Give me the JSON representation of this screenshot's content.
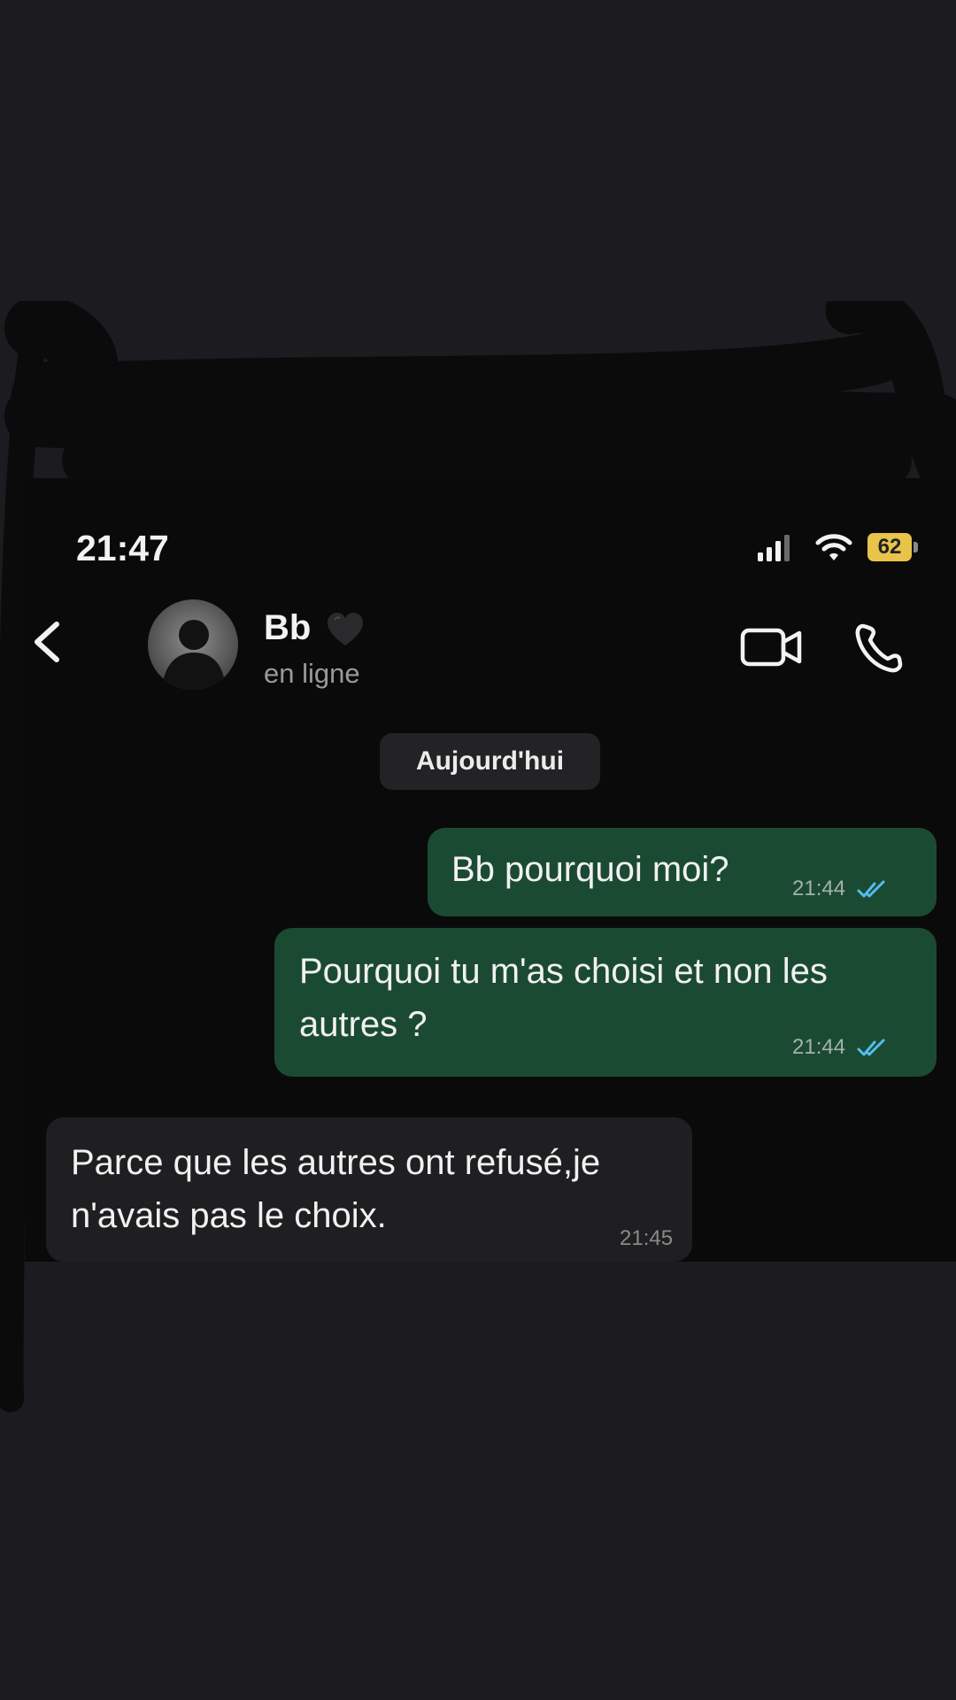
{
  "status_bar": {
    "time": "21:47",
    "battery_level": "62",
    "icons": [
      "signal-icon",
      "wifi-icon",
      "battery-icon"
    ]
  },
  "header": {
    "contact_name": "Bb",
    "contact_status": "en ligne",
    "icons": [
      "back-chevron-icon",
      "avatar",
      "black-heart-icon",
      "video-camera-icon",
      "phone-icon"
    ]
  },
  "chat": {
    "date_label": "Aujourd'hui",
    "messages": [
      {
        "direction": "outgoing",
        "lines": [
          "Bb pourquoi moi?"
        ],
        "time": "21:44",
        "read_receipt": "double-check-icon"
      },
      {
        "direction": "outgoing",
        "lines": [
          "Pourquoi tu m'as choisi et non les",
          "autres ?"
        ],
        "time": "21:44",
        "read_receipt": "double-check-icon"
      },
      {
        "direction": "incoming",
        "lines": [
          "Parce que les autres ont refusé,je",
          "n'avais pas le choix."
        ],
        "time": "21:45"
      }
    ]
  },
  "colors": {
    "page_background": "#1c1b20",
    "chat_background": "#0a0a0b",
    "outgoing_bubble": "#1b4a33",
    "incoming_bubble": "#1f1f21",
    "read_check": "#53bdeb",
    "battery": "#e8c44a"
  }
}
